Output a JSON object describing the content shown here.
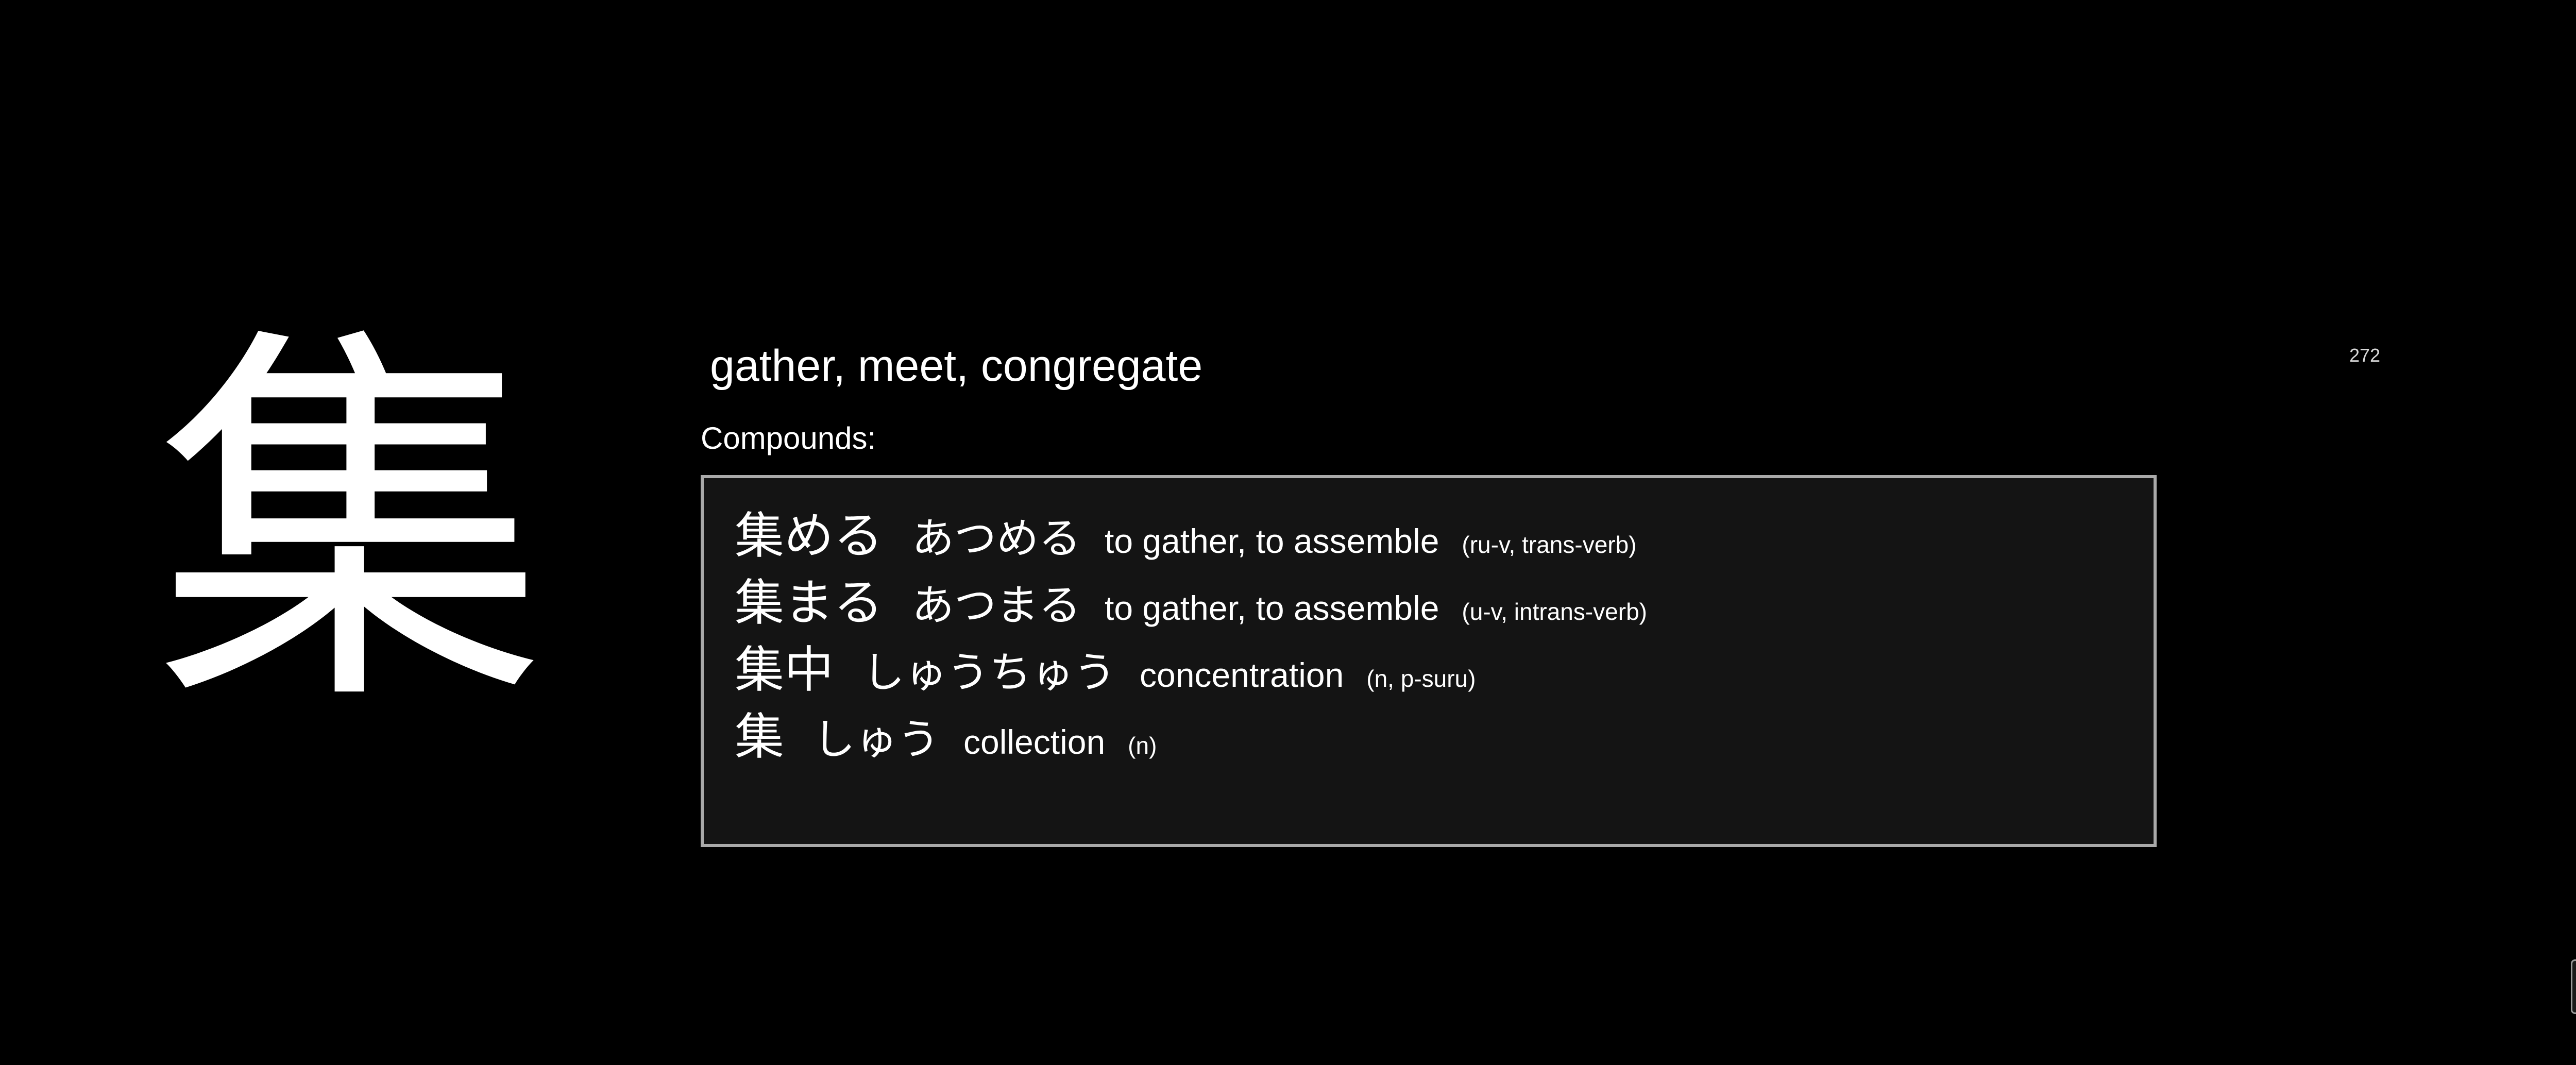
{
  "kanji": {
    "character": "集",
    "meaning": "gather, meet, congregate",
    "number": "272"
  },
  "compounds": {
    "label": "Compounds:",
    "items": [
      {
        "kanji": "集める",
        "reading": "あつめる",
        "meaning": "to gather, to assemble",
        "pos": "(ru-v, trans-verb)"
      },
      {
        "kanji": "集まる",
        "reading": "あつまる",
        "meaning": "to gather, to assemble",
        "pos": "(u-v, intrans-verb)"
      },
      {
        "kanji": "集中",
        "reading": "しゅうちゅう",
        "meaning": "concentration",
        "pos": "(n, p-suru)"
      },
      {
        "kanji": "集",
        "reading": "しゅう",
        "meaning": "collection",
        "pos": "(n)"
      }
    ]
  },
  "colors": {
    "background": "#000000",
    "text": "#ffffff",
    "box_background": "#141414",
    "box_border": "#a9a9a9"
  }
}
